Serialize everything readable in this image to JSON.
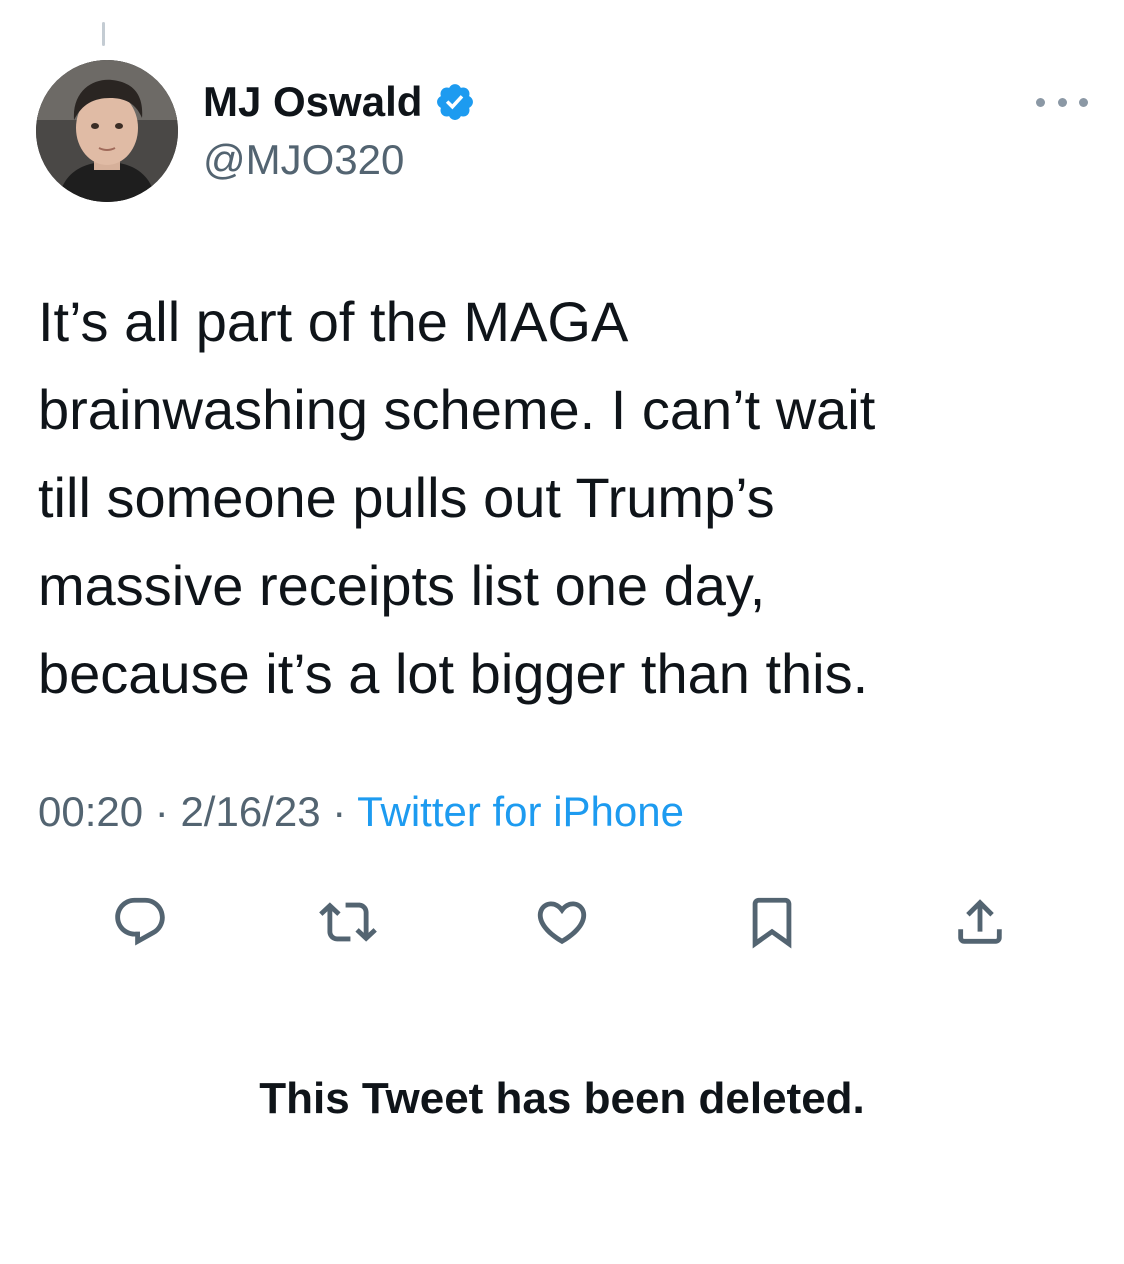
{
  "tweet": {
    "author": {
      "display_name": "MJ Oswald",
      "handle": "@MJO320",
      "verified": true,
      "avatar": "profile-photo"
    },
    "text_lines": [
      "It’s all part of the MAGA",
      "brainwashing scheme. I can’t wait",
      "till someone pulls out Trump’s",
      "massive receipts list one day,",
      "because it’s a lot bigger than this."
    ],
    "time": "00:20",
    "separator": " · ",
    "date": "2/16/23",
    "source": "Twitter for iPhone",
    "actions": [
      {
        "name": "reply",
        "icon": "reply-icon"
      },
      {
        "name": "retweet",
        "icon": "retweet-icon"
      },
      {
        "name": "like",
        "icon": "heart-icon"
      },
      {
        "name": "bookmark",
        "icon": "bookmark-icon"
      },
      {
        "name": "share",
        "icon": "share-icon"
      }
    ]
  },
  "status_note": "This Tweet has been deleted.",
  "colors": {
    "text_primary": "#0f1419",
    "text_secondary": "#536471",
    "accent": "#1d9bf0",
    "icon_gray": "#536471"
  }
}
